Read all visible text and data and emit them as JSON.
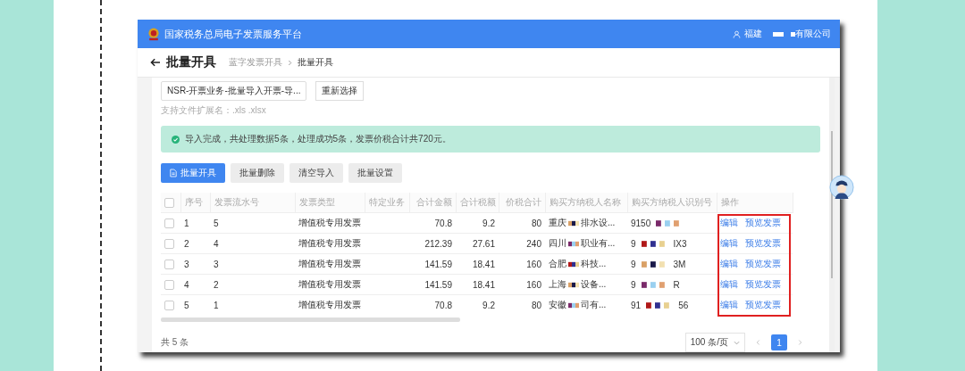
{
  "header": {
    "title": "国家税务总局电子发票服务平台",
    "user": "福建",
    "company": "有限公司"
  },
  "page": {
    "title": "批量开具",
    "breadcrumb": [
      "蓝字发票开具",
      "批量开具"
    ]
  },
  "file": {
    "value": "NSR-开票业务-批量导入开票-导...",
    "button": "重新选择",
    "hint": "支持文件扩展名：.xls .xlsx"
  },
  "alert": {
    "kind": "success",
    "text": "导入完成，共处理数据5条，处理成功5条，发票价税合计共720元。"
  },
  "toolbar": [
    {
      "label": "批量开具",
      "kind": "primary"
    },
    {
      "label": "批量删除",
      "kind": "default"
    },
    {
      "label": "清空导入",
      "kind": "default"
    },
    {
      "label": "批量设置",
      "kind": "default"
    }
  ],
  "table": {
    "columns": [
      "序号",
      "发票流水号",
      "发票类型",
      "特定业务",
      "合计金额",
      "合计税额",
      "价税合计",
      "购买方纳税人名称",
      "购买方纳税人识别号",
      "操作"
    ],
    "operations_highlighted": true,
    "all_checked": false,
    "rows": [
      {
        "checked": false,
        "no": "1",
        "serial": "5",
        "type": "增值税专用发票",
        "amount": "70.8",
        "tax": "9.2",
        "total": "80",
        "buyer_start": "重庆",
        "buyer_end": "排水设...",
        "id_start": "9150",
        "actions": [
          "编辑",
          "预览发票"
        ]
      },
      {
        "checked": false,
        "no": "2",
        "serial": "4",
        "type": "增值税专用发票",
        "amount": "212.39",
        "tax": "27.61",
        "total": "240",
        "buyer_start": "四川",
        "buyer_end": "职业有...",
        "id_start": "9",
        "id_end": "IX3",
        "actions": [
          "编辑",
          "预览发票"
        ]
      },
      {
        "checked": false,
        "no": "3",
        "serial": "3",
        "type": "增值税专用发票",
        "amount": "141.59",
        "tax": "18.41",
        "total": "160",
        "buyer_start": "合肥",
        "buyer_end": "科技...",
        "id_start": "9",
        "id_end": "3M",
        "actions": [
          "编辑",
          "预览发票"
        ]
      },
      {
        "checked": false,
        "no": "4",
        "serial": "2",
        "type": "增值税专用发票",
        "amount": "141.59",
        "tax": "18.41",
        "total": "160",
        "buyer_start": "上海",
        "buyer_end": "设备...",
        "id_start": "9",
        "id_end": "R",
        "actions": [
          "编辑",
          "预览发票"
        ]
      },
      {
        "checked": false,
        "no": "5",
        "serial": "1",
        "type": "增值税专用发票",
        "amount": "70.8",
        "tax": "9.2",
        "total": "80",
        "buyer_start": "安徽",
        "buyer_end": "司有...",
        "id_start": "91",
        "id_end": "56",
        "actions": [
          "编辑",
          "预览发票"
        ]
      }
    ]
  },
  "footer": {
    "total": "共 5 条",
    "page_size": "100 条/页",
    "pages": [
      {
        "label": "1",
        "selected": true
      }
    ]
  }
}
